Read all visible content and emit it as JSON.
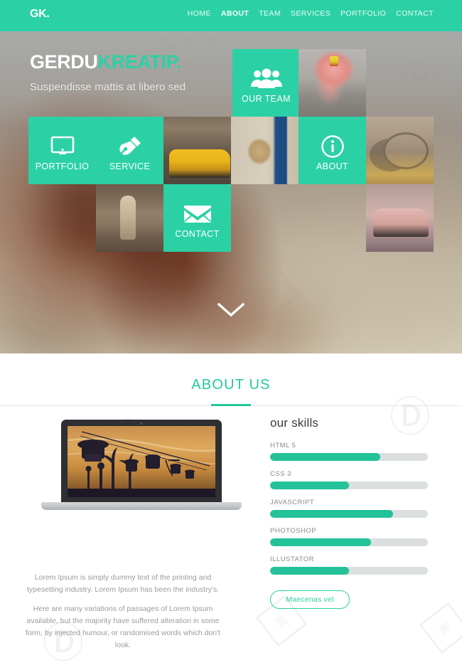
{
  "header": {
    "logo": "GK.",
    "nav": [
      {
        "label": "HOME",
        "active": false
      },
      {
        "label": "ABOUT",
        "active": true
      },
      {
        "label": "TEAM",
        "active": false
      },
      {
        "label": "SERVICES",
        "active": false
      },
      {
        "label": "PORTFOLIO",
        "active": false
      },
      {
        "label": "CONTACT",
        "active": false
      }
    ],
    "accent_color": "#2bd1a4"
  },
  "hero": {
    "title_white": "GERDU",
    "title_accent": "KREATIP.",
    "subtitle": "Suspendisse mattis at libero sed",
    "scroll_icon": "chevron-down-icon",
    "tiles": [
      {
        "id": "our-team",
        "label": "OUR TEAM",
        "icon": "users-icon",
        "type": "teal"
      },
      {
        "id": "portfolio",
        "label": "PORTFOLIO",
        "icon": "monitor-icon",
        "type": "teal"
      },
      {
        "id": "service",
        "label": "SERVICE",
        "icon": "pen-nib-icon",
        "type": "teal"
      },
      {
        "id": "about",
        "label": "ABOUT",
        "icon": "info-circle-icon",
        "type": "teal"
      },
      {
        "id": "contact",
        "label": "CONTACT",
        "icon": "envelope-icon",
        "type": "teal"
      }
    ],
    "photos": [
      {
        "id": "flamingo-costume",
        "type": "photo"
      },
      {
        "id": "yellow-taxi",
        "type": "photo"
      },
      {
        "id": "dog-blue-door",
        "type": "photo"
      },
      {
        "id": "bicycles-autumn",
        "type": "photo"
      },
      {
        "id": "child-vintage",
        "type": "photo"
      },
      {
        "id": "pink-truck",
        "type": "photo"
      }
    ]
  },
  "about": {
    "section_title": "ABOUT US",
    "laptop_image": "cable-cars-sunset-photo",
    "skills_title": "our skills",
    "skills": [
      {
        "label": "HTML 5",
        "value": 70
      },
      {
        "label": "CSS 3",
        "value": 50
      },
      {
        "label": "JAVASCRIPT",
        "value": 78
      },
      {
        "label": "PHOTOSHOP",
        "value": 64
      },
      {
        "label": "ILLUSTATOR",
        "value": 50
      }
    ],
    "paragraphs": [
      "Lorem Ipsum is simply dummy text of the printing and typesetting industry. Lorem Ipsum has been the industry's.",
      "Here are many variations of passages of Lorem Ipsum available, but the majority have suffered alteration in some form, by injected humour, or randomised words which don't look."
    ],
    "cta_label": "Maecenas vel",
    "accent_color": "#2bd1a4"
  }
}
